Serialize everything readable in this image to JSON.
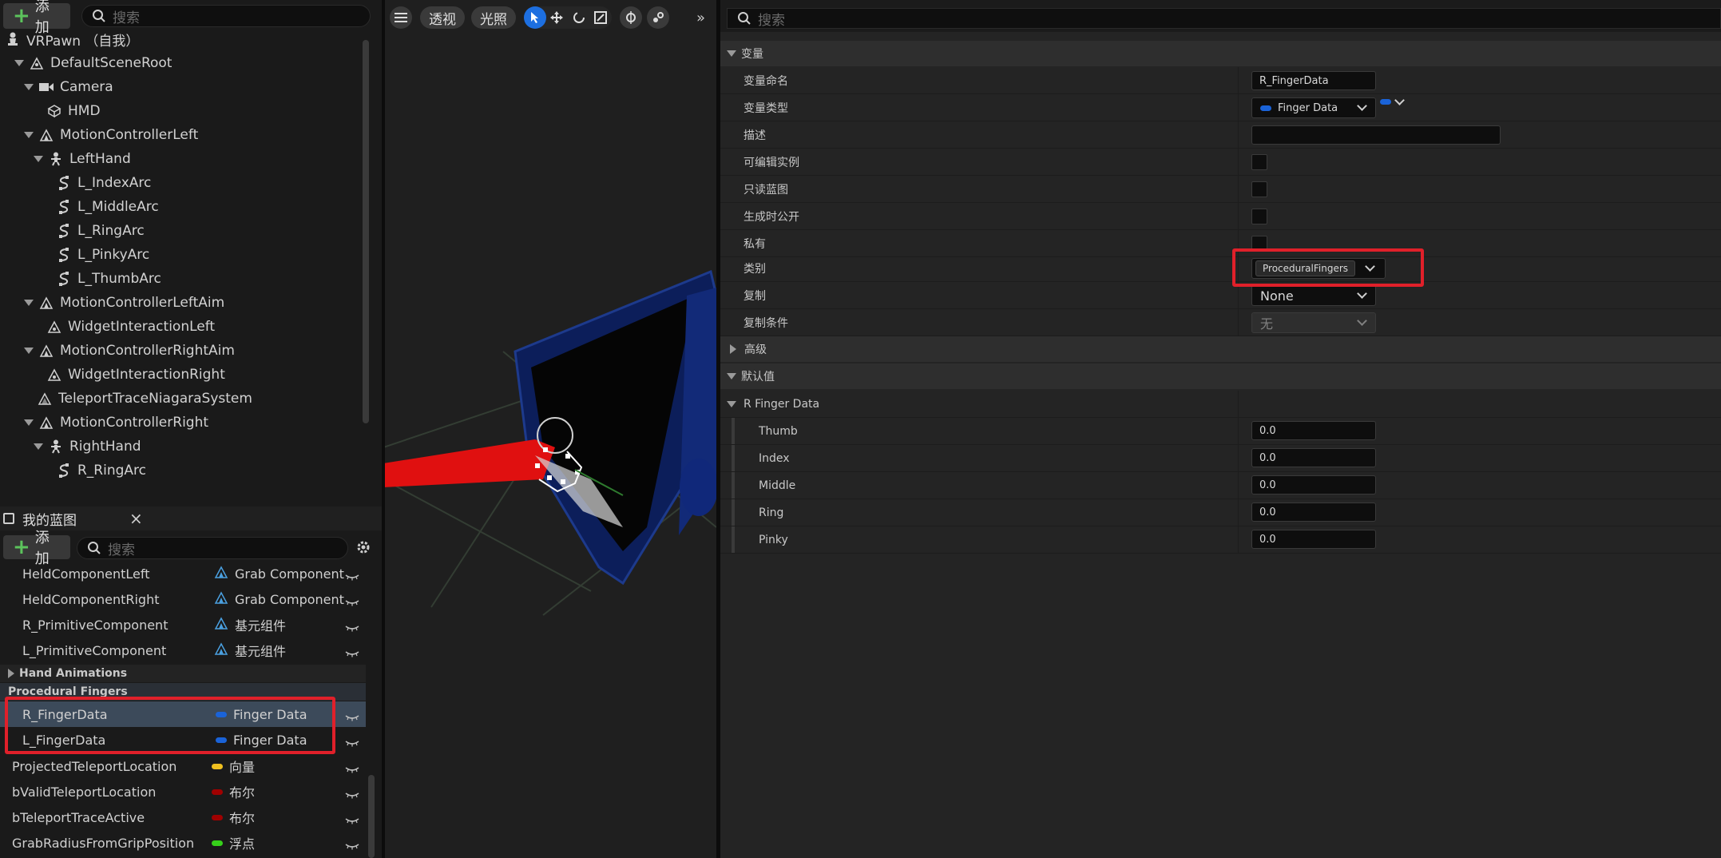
{
  "components_panel": {
    "add_label": "添加",
    "search_placeholder": "搜索",
    "tree": [
      {
        "label": "VRPawn （自我）",
        "icon": "pawn-icon"
      },
      {
        "label": "DefaultSceneRoot",
        "icon": "scene-root-icon"
      },
      {
        "label": "Camera",
        "icon": "camera-icon"
      },
      {
        "label": "HMD",
        "icon": "mesh-cube-icon"
      },
      {
        "label": "MotionControllerLeft",
        "icon": "motion-controller-icon"
      },
      {
        "label": "LeftHand",
        "icon": "skeleton-icon"
      },
      {
        "label": "L_IndexArc",
        "icon": "spline-icon"
      },
      {
        "label": "L_MiddleArc",
        "icon": "spline-icon"
      },
      {
        "label": "L_RingArc",
        "icon": "spline-icon"
      },
      {
        "label": "L_PinkyArc",
        "icon": "spline-icon"
      },
      {
        "label": "L_ThumbArc",
        "icon": "spline-icon"
      },
      {
        "label": "MotionControllerLeftAim",
        "icon": "motion-controller-icon"
      },
      {
        "label": "WidgetInteractionLeft",
        "icon": "widget-interaction-icon"
      },
      {
        "label": "MotionControllerRightAim",
        "icon": "motion-controller-icon"
      },
      {
        "label": "WidgetInteractionRight",
        "icon": "widget-interaction-icon"
      },
      {
        "label": "TeleportTraceNiagaraSystem",
        "icon": "niagara-icon"
      },
      {
        "label": "MotionControllerRight",
        "icon": "motion-controller-icon"
      },
      {
        "label": "RightHand",
        "icon": "skeleton-icon"
      },
      {
        "label": "R_RingArc",
        "icon": "spline-icon"
      }
    ]
  },
  "my_blueprint": {
    "tab_title": "我的蓝图",
    "close": "×",
    "add_label": "添加",
    "search_placeholder": "搜索",
    "variables": [
      {
        "name": "HeldComponentLeft",
        "type": "Grab Component"
      },
      {
        "name": "HeldComponentRight",
        "type": "Grab Component"
      },
      {
        "name": "R_PrimitiveComponent",
        "type": "基元组件"
      },
      {
        "name": "L_PrimitiveComponent",
        "type": "基元组件"
      }
    ],
    "category_hand_animations": "Hand Animations",
    "category_procedural_fingers": "Procedural Fingers",
    "procedural_vars": [
      {
        "name": "R_FingerData",
        "type": "Finger Data",
        "color": "#1a63d8"
      },
      {
        "name": "L_FingerData",
        "type": "Finger Data",
        "color": "#1a63d8"
      }
    ],
    "other_vars": [
      {
        "name": "ProjectedTeleportLocation",
        "type": "向量",
        "color": "#f0c020"
      },
      {
        "name": "bValidTeleportLocation",
        "type": "布尔",
        "color": "#a00000"
      },
      {
        "name": "bTeleportTraceActive",
        "type": "布尔",
        "color": "#a00000"
      },
      {
        "name": "GrabRadiusFromGripPosition",
        "type": "浮点",
        "color": "#36d01a"
      }
    ]
  },
  "viewport": {
    "perspective": "透视",
    "lighting": "光照"
  },
  "details": {
    "search_placeholder": "搜索",
    "section_variable": "变量",
    "rows": {
      "name_label": "变量命名",
      "name_value": "R_FingerData",
      "type_label": "变量类型",
      "type_value": "Finger Data",
      "desc_label": "描述",
      "editable_label": "可编辑实例",
      "readonly_label": "只读蓝图",
      "expose_label": "生成时公开",
      "private_label": "私有",
      "category_label": "类别",
      "category_value": "ProceduralFingers",
      "replication_label": "复制",
      "replication_value": "None",
      "repcond_label": "复制条件",
      "repcond_value": "无"
    },
    "section_advanced": "高级",
    "section_default": "默认值",
    "struct_label": "R Finger Data",
    "fingers": [
      {
        "label": "Thumb",
        "value": "0.0"
      },
      {
        "label": "Index",
        "value": "0.0"
      },
      {
        "label": "Middle",
        "value": "0.0"
      },
      {
        "label": "Ring",
        "value": "0.0"
      },
      {
        "label": "Pinky",
        "value": "0.0"
      }
    ]
  },
  "colors": {
    "accent_blue": "#1a63d8",
    "highlight_red": "#e0202a"
  }
}
